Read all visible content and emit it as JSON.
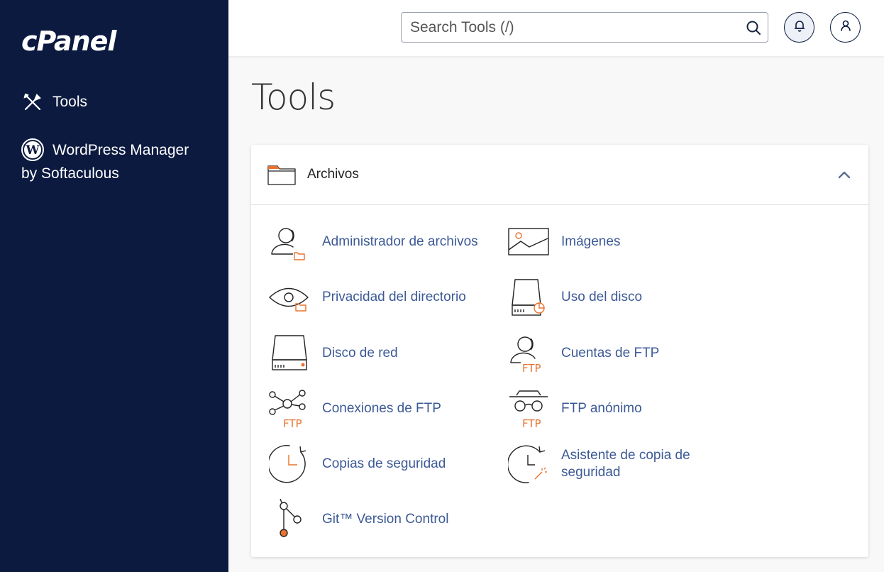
{
  "sidebar": {
    "logo": "cPanel",
    "items": [
      {
        "label": "Tools",
        "icon": "tools-icon"
      },
      {
        "label_line1": "WordPress Manager",
        "label_line2": "by Softaculous",
        "icon": "wordpress-icon"
      }
    ]
  },
  "header": {
    "search_placeholder": "Search Tools (/)",
    "icons": [
      "search-icon",
      "bell-icon",
      "user-icon"
    ]
  },
  "page": {
    "title": "Tools"
  },
  "section": {
    "title": "Archivos",
    "icon": "folder-icon",
    "tools": [
      {
        "label": "Administrador de archivos",
        "icon": "file-manager-icon"
      },
      {
        "label": "Imágenes",
        "icon": "images-icon"
      },
      {
        "label": "Privacidad del directorio",
        "icon": "directory-privacy-icon"
      },
      {
        "label": "Uso del disco",
        "icon": "disk-usage-icon"
      },
      {
        "label": "Disco de red",
        "icon": "network-disk-icon"
      },
      {
        "label": "Cuentas de FTP",
        "icon": "ftp-accounts-icon"
      },
      {
        "label": "Conexiones de FTP",
        "icon": "ftp-connections-icon"
      },
      {
        "label": "FTP anónimo",
        "icon": "anonymous-ftp-icon"
      },
      {
        "label": "Copias de seguridad",
        "icon": "backup-icon"
      },
      {
        "label_line1": "Asistente de copia de",
        "label_line2": "seguridad",
        "icon": "backup-wizard-icon"
      },
      {
        "label": "Git™ Version Control",
        "icon": "git-icon"
      }
    ]
  },
  "colors": {
    "sidebar_bg": "#0c1a40",
    "accent_orange": "#e8722e",
    "link_blue": "#3d5a96"
  }
}
